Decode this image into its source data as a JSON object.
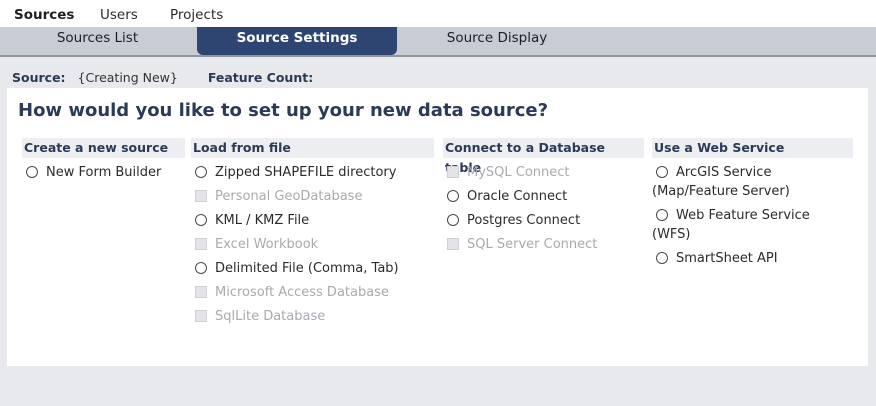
{
  "topnav": {
    "items": [
      {
        "label": "Sources",
        "active": true
      },
      {
        "label": "Users",
        "active": false
      },
      {
        "label": "Projects",
        "active": false
      }
    ]
  },
  "subtabs": {
    "items": [
      {
        "label": "Sources List",
        "active": false
      },
      {
        "label": "Source Settings",
        "active": true
      },
      {
        "label": "Source Display",
        "active": false
      }
    ]
  },
  "info": {
    "source_label": "Source:",
    "source_value": "{Creating New}",
    "feature_count_label": "Feature Count:"
  },
  "panel": {
    "title": "How would you like to set up your new data source?",
    "columns": [
      {
        "header": "Create a new source",
        "options": [
          {
            "label": "New Form Builder",
            "control": "radio",
            "enabled": true
          }
        ]
      },
      {
        "header": "Load from file",
        "options": [
          {
            "label": "Zipped SHAPEFILE directory",
            "control": "radio",
            "enabled": true
          },
          {
            "label": "Personal GeoDatabase",
            "control": "checkbox",
            "enabled": false
          },
          {
            "label": "KML / KMZ File",
            "control": "radio",
            "enabled": true
          },
          {
            "label": "Excel Workbook",
            "control": "checkbox",
            "enabled": false
          },
          {
            "label": "Delimited File (Comma, Tab)",
            "control": "radio",
            "enabled": true
          },
          {
            "label": "Microsoft Access Database",
            "control": "checkbox",
            "enabled": false
          },
          {
            "label": "SqlLite Database",
            "control": "checkbox",
            "enabled": false
          }
        ]
      },
      {
        "header": "Connect to a Database table",
        "options": [
          {
            "label": "MySQL Connect",
            "control": "checkbox",
            "enabled": false
          },
          {
            "label": "Oracle Connect",
            "control": "radio",
            "enabled": true
          },
          {
            "label": "Postgres Connect",
            "control": "radio",
            "enabled": true
          },
          {
            "label": "SQL Server Connect",
            "control": "checkbox",
            "enabled": false
          }
        ]
      },
      {
        "header": "Use a Web Service",
        "options": [
          {
            "label": "ArcGIS Service",
            "label2": "(Map/Feature Server)",
            "control": "radio",
            "enabled": true
          },
          {
            "label": "Web Feature Service",
            "label2": "(WFS)",
            "control": "radio",
            "enabled": true
          },
          {
            "label": "SmartSheet API",
            "control": "radio",
            "enabled": true
          }
        ]
      }
    ]
  },
  "colors": {
    "accent": "#2f4571",
    "heading": "#2b3a55",
    "disabled_text": "#a7aab0"
  }
}
